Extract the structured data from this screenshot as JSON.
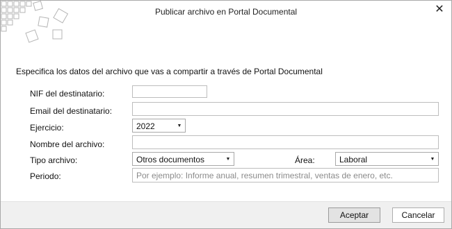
{
  "dialog": {
    "title": "Publicar archivo en Portal Documental",
    "close_icon": "✕"
  },
  "intro_text": "Especifica los datos del archivo que vas a compartir a través de Portal Documental",
  "form": {
    "nif_label": "NIF del destinatario:",
    "nif_value": "",
    "email_label": "Email del destinatario:",
    "email_value": "",
    "ejercicio_label": "Ejercicio:",
    "ejercicio_value": "2022",
    "nombre_label": "Nombre del archivo:",
    "nombre_value": "",
    "tipo_label": "Tipo archivo:",
    "tipo_value": "Otros documentos",
    "area_label": "Área:",
    "area_value": "Laboral",
    "periodo_label": "Periodo:",
    "periodo_placeholder": "Por ejemplo: Informe anual, resumen trimestral, ventas de enero, etc."
  },
  "buttons": {
    "accept": "Aceptar",
    "cancel": "Cancelar"
  },
  "icons": {
    "logo": "diagonal-squares-logo",
    "close": "close-icon",
    "dropdown": "chevron-down-icon"
  }
}
